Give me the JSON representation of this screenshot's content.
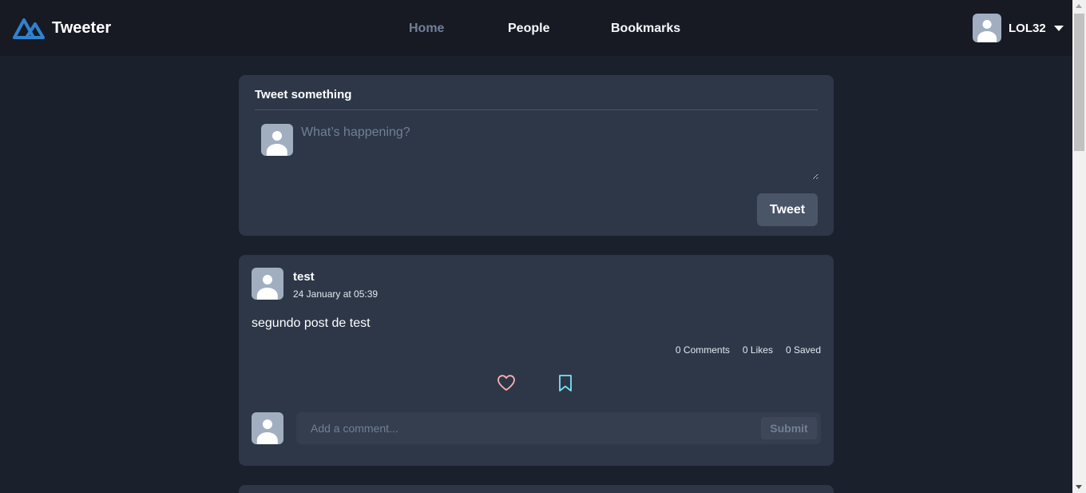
{
  "navbar": {
    "brand": "Tweeter",
    "links": [
      {
        "label": "Home",
        "active": true
      },
      {
        "label": "People",
        "active": false
      },
      {
        "label": "Bookmarks",
        "active": false
      }
    ],
    "user": {
      "name": "LOL32",
      "icon": "chevron-down-icon"
    }
  },
  "compose": {
    "title": "Tweet something",
    "placeholder": "What’s happening?",
    "button": "Tweet"
  },
  "post": {
    "author": "test",
    "date": "24 January at 05:39",
    "content": "segundo post de test",
    "stats": {
      "comments": "0 Comments",
      "likes": "0 Likes",
      "saved": "0 Saved"
    },
    "actions": {
      "like_icon": "heart-icon",
      "bookmark_icon": "bookmark-icon"
    },
    "comment": {
      "placeholder": "Add a comment...",
      "submit": "Submit"
    }
  },
  "colors": {
    "background": "#1a202c",
    "navbar": "#171923",
    "card": "#2d3748",
    "brand_logo": "#3182ce",
    "like": "#feb2b2",
    "bookmark": "#76e4f7"
  }
}
